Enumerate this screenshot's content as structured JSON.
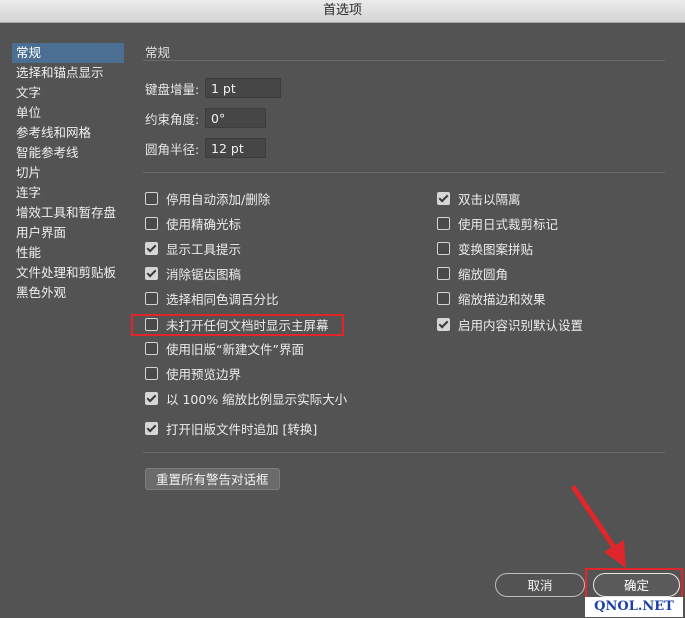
{
  "window": {
    "title": "首选项"
  },
  "sidebar": {
    "items": [
      {
        "label": "常规",
        "active": true
      },
      {
        "label": "选择和锚点显示"
      },
      {
        "label": "文字"
      },
      {
        "label": "单位"
      },
      {
        "label": "参考线和网格"
      },
      {
        "label": "智能参考线"
      },
      {
        "label": "切片"
      },
      {
        "label": "连字"
      },
      {
        "label": "增效工具和暂存盘"
      },
      {
        "label": "用户界面"
      },
      {
        "label": "性能"
      },
      {
        "label": "文件处理和剪贴板"
      },
      {
        "label": "黑色外观"
      }
    ]
  },
  "main": {
    "section_title": "常规",
    "fields": {
      "keyboard_increment": {
        "label": "键盘增量:",
        "value": "1 pt"
      },
      "constrain_angle": {
        "label": "约束角度:",
        "value": "0°"
      },
      "corner_radius": {
        "label": "圆角半径:",
        "value": "12 pt"
      }
    },
    "left_options": [
      {
        "label": "停用自动添加/删除",
        "checked": false
      },
      {
        "label": "使用精确光标",
        "checked": false
      },
      {
        "label": "显示工具提示",
        "checked": true
      },
      {
        "label": "消除锯齿图稿",
        "checked": true
      },
      {
        "label": "选择相同色调百分比",
        "checked": false
      },
      {
        "label": "未打开任何文档时显示主屏幕",
        "checked": false
      },
      {
        "label": "使用旧版“新建文件”界面",
        "checked": false
      },
      {
        "label": "使用预览边界",
        "checked": false
      },
      {
        "label": "以 100% 缩放比例显示实际大小",
        "checked": true
      },
      {
        "label": "打开旧版文件时追加 [转换]",
        "checked": true
      }
    ],
    "right_options": [
      {
        "label": "双击以隔离",
        "checked": true
      },
      {
        "label": "使用日式裁剪标记",
        "checked": false
      },
      {
        "label": "变换图案拼贴",
        "checked": false
      },
      {
        "label": "缩放圆角",
        "checked": false
      },
      {
        "label": "缩放描边和效果",
        "checked": false
      },
      {
        "label": "启用内容识别默认设置",
        "checked": true
      }
    ],
    "reset_button": "重置所有警告对话框"
  },
  "footer": {
    "cancel_label": "取消",
    "ok_label": "确定"
  },
  "watermark": "QNOL.NET",
  "colors": {
    "background": "#535353",
    "sidebar_active": "#4a6f93",
    "annotation_red": "#e0262b"
  }
}
